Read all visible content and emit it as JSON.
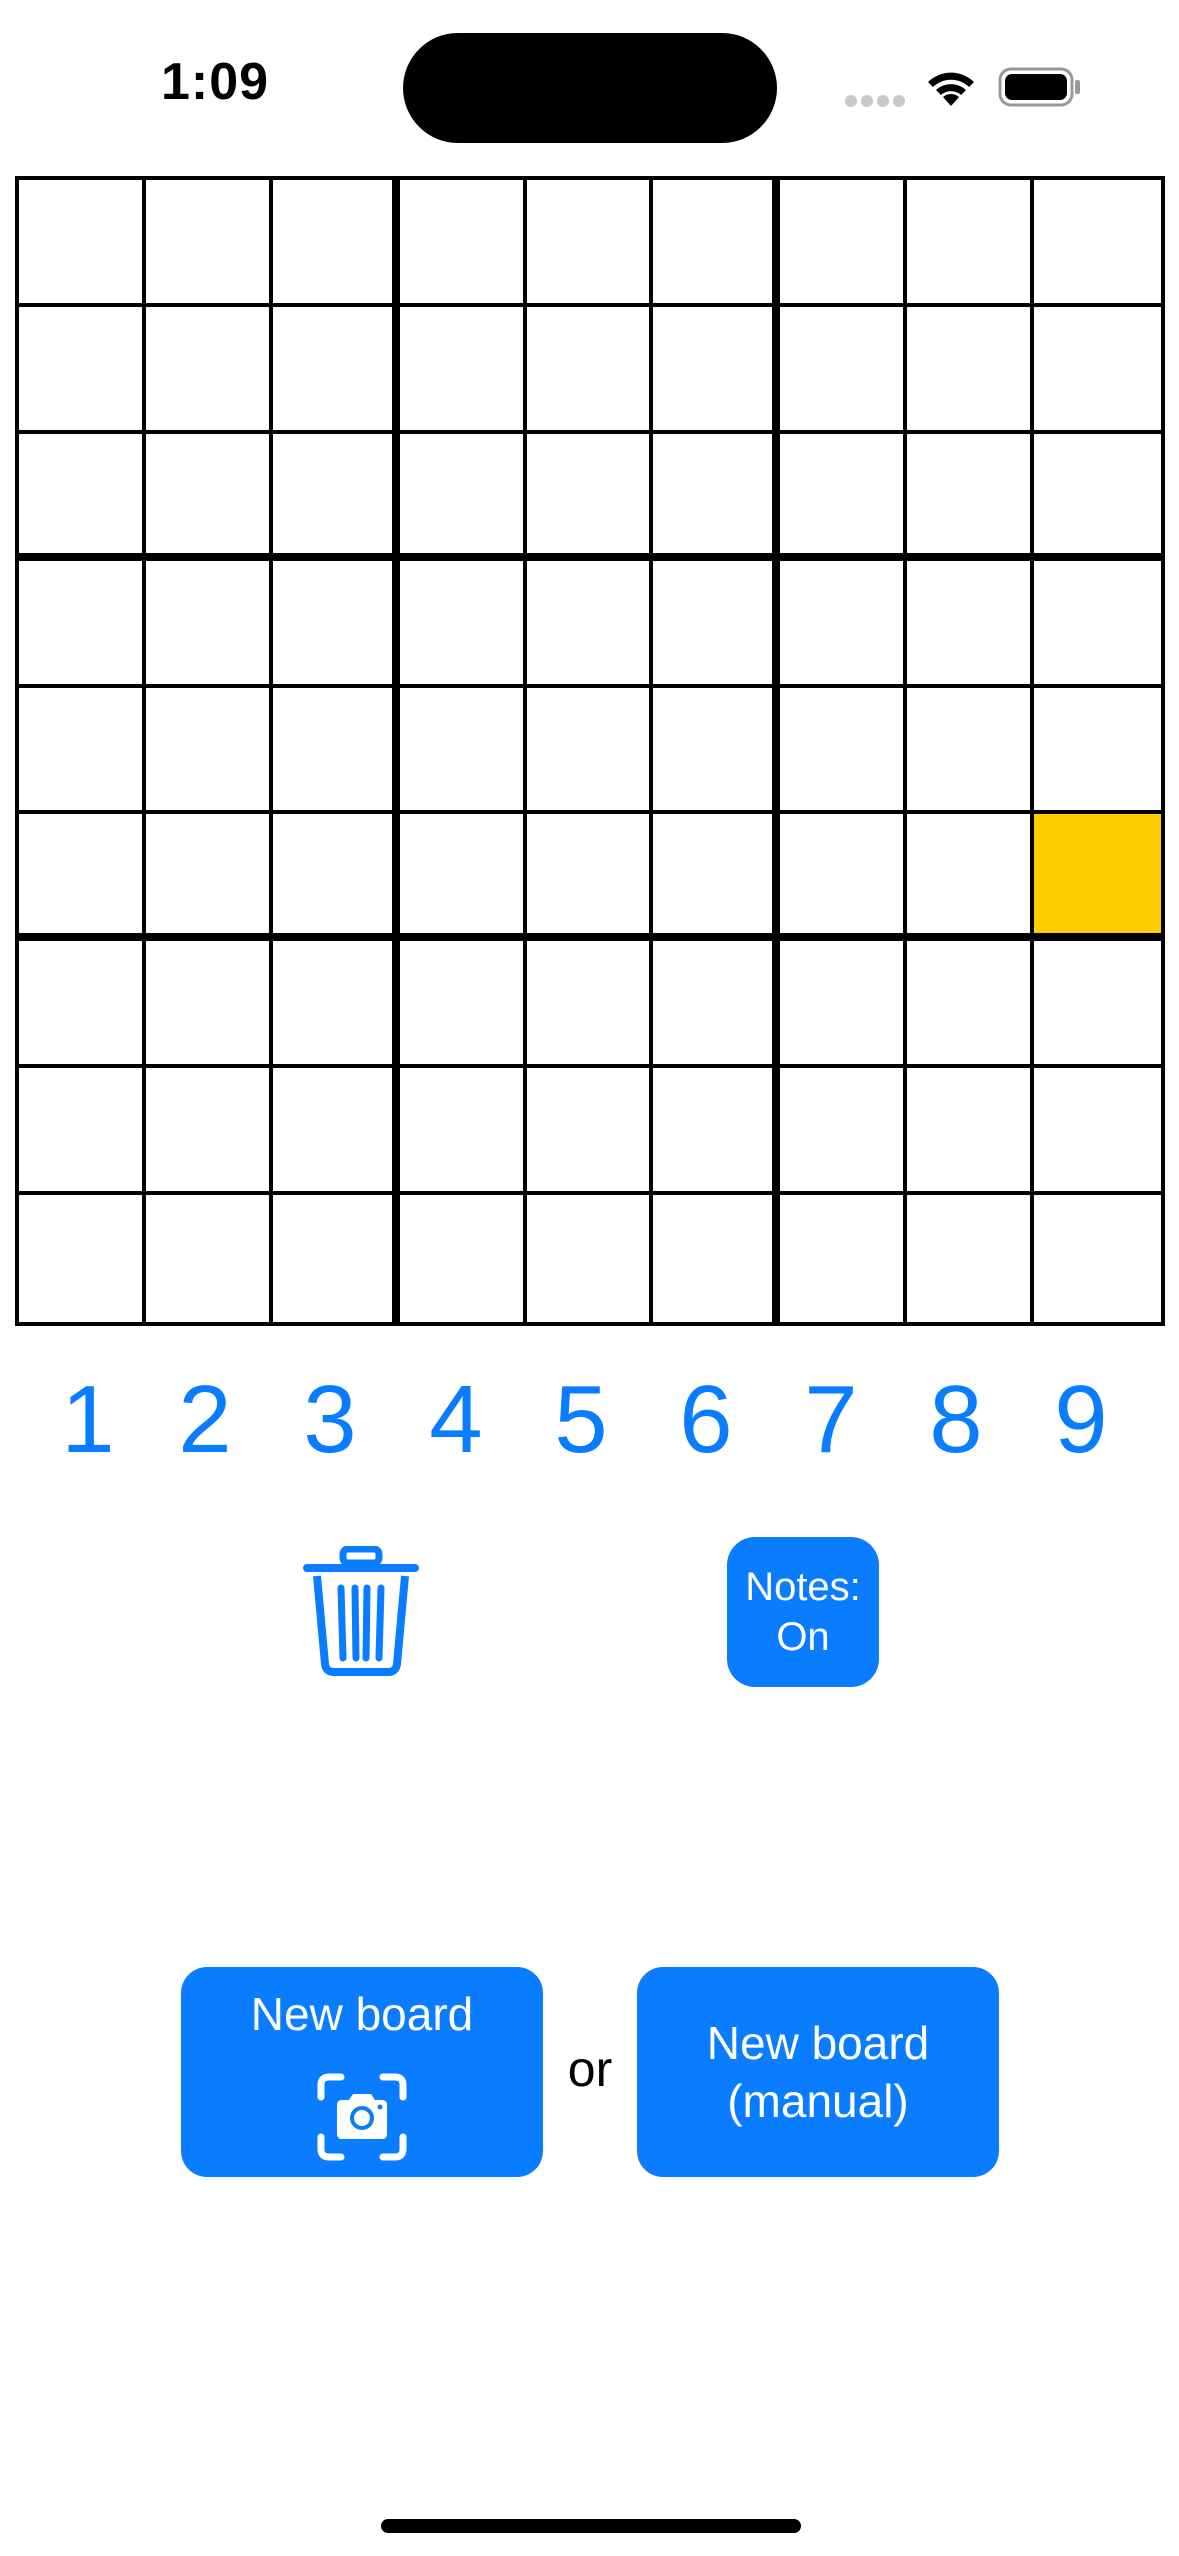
{
  "status_bar": {
    "time": "1:09"
  },
  "board": {
    "size": 9,
    "selected_cell": {
      "row": 5,
      "col": 8
    },
    "selected_color": "#ffcc00"
  },
  "numpad": {
    "keys": [
      "1",
      "2",
      "3",
      "4",
      "5",
      "6",
      "7",
      "8",
      "9"
    ]
  },
  "toolbar": {
    "delete_icon": "trash-icon",
    "notes_line1": "Notes:",
    "notes_line2": "On"
  },
  "actions": {
    "new_board_camera_label": "New board",
    "camera_icon": "camera-scan-icon",
    "or_label": "or",
    "new_board_manual_line1": "New board",
    "new_board_manual_line2": "(manual)"
  },
  "colors": {
    "accent": "#0a7cff",
    "grid_lines": "#000000",
    "background": "#ffffff"
  }
}
